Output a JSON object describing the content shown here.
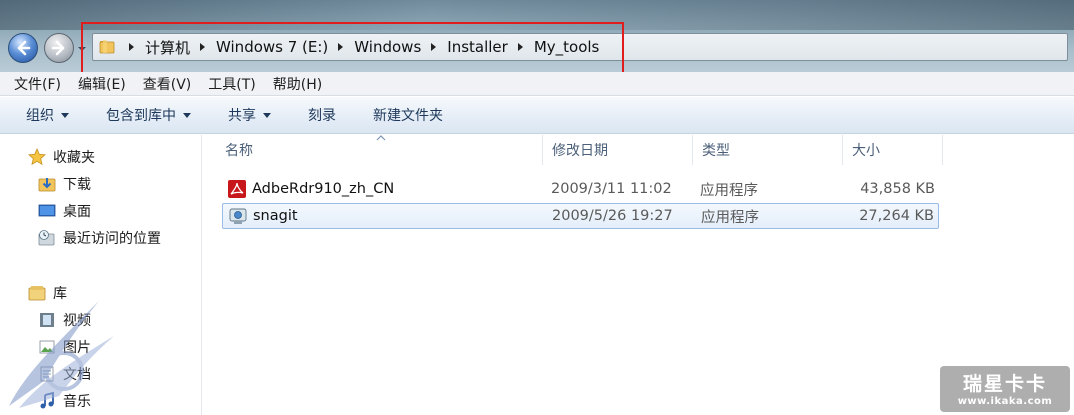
{
  "address_bar": {
    "breadcrumbs": [
      "计算机",
      "Windows 7 (E:)",
      "Windows",
      "Installer",
      "My_tools"
    ]
  },
  "menu": {
    "items": [
      "文件(F)",
      "编辑(E)",
      "查看(V)",
      "工具(T)",
      "帮助(H)"
    ]
  },
  "toolbar": {
    "organize": "组织",
    "include_library": "包含到库中",
    "share": "共享",
    "burn": "刻录",
    "new_folder": "新建文件夹"
  },
  "nav_pane": {
    "favorites": "收藏夹",
    "downloads": "下载",
    "desktop": "桌面",
    "recent": "最近访问的位置",
    "libraries": "库",
    "videos": "视频",
    "pictures": "图片",
    "documents": "文档",
    "music": "音乐"
  },
  "columns": {
    "name": "名称",
    "date": "修改日期",
    "type": "类型",
    "size": "大小"
  },
  "files": [
    {
      "name": "AdbeRdr910_zh_CN",
      "date": "2009/3/11 11:02",
      "type": "应用程序",
      "size": "43,858 KB",
      "icon": "adobe-reader-icon"
    },
    {
      "name": "snagit",
      "date": "2009/5/26 19:27",
      "type": "应用程序",
      "size": "27,264 KB",
      "icon": "snagit-icon"
    }
  ],
  "watermark": {
    "brand": "瑞星卡卡",
    "url": "www.ikaka.com"
  },
  "colors": {
    "highlight_box": "#e01c1c",
    "selection_border": "#99bde6",
    "command_text": "#1e395b"
  }
}
